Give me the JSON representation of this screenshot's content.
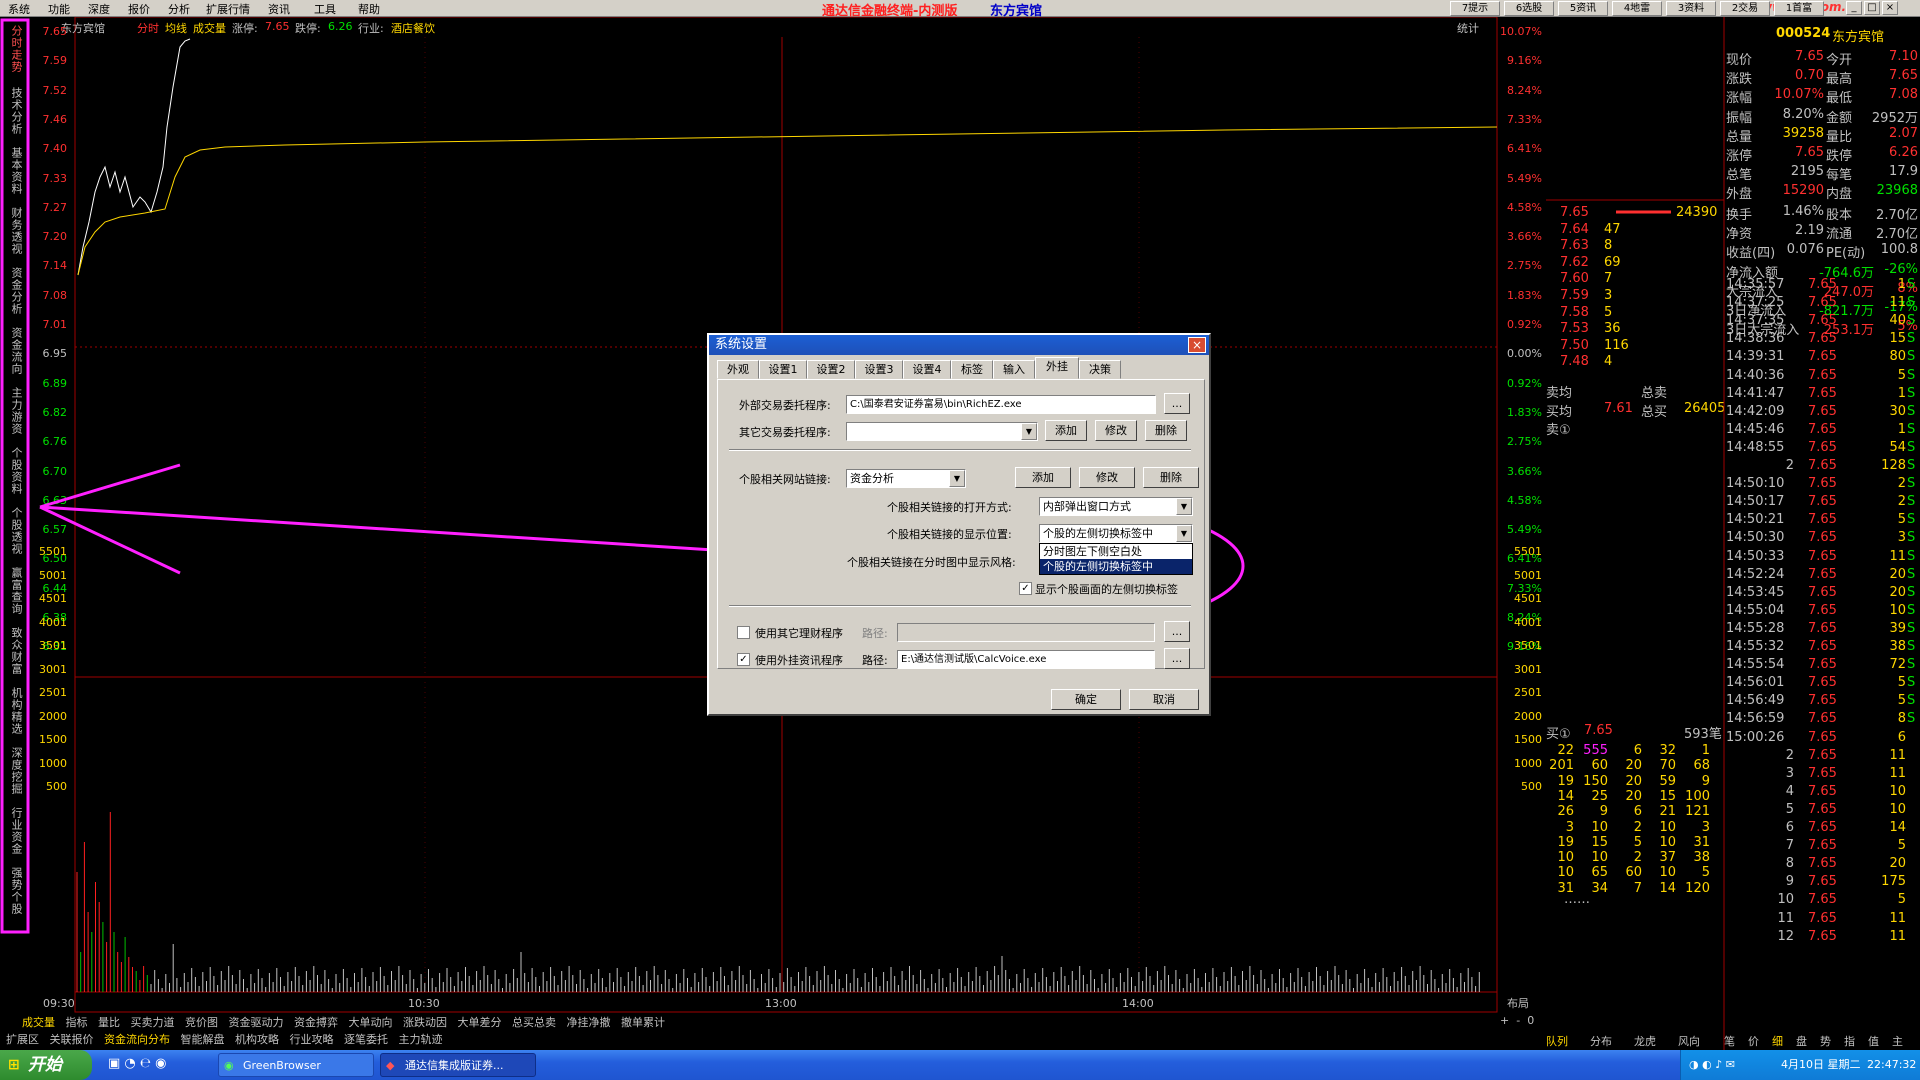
{
  "menubar": {
    "items": [
      "系统",
      "功能",
      "深度",
      "报价",
      "分析",
      "扩展行情",
      "资讯",
      "工具",
      "帮助"
    ],
    "title": "通达信金融终端-内测版",
    "stock_name": "东方宾馆",
    "quick_buttons": [
      "7提示",
      "6选股",
      "5资讯",
      "4地雷",
      "3资料",
      "2交易",
      "1首富"
    ],
    "window_buttons": [
      "_",
      "□",
      "×"
    ],
    "watermark": "www.tdx.com.cn"
  },
  "left_tabs": [
    "分时走势",
    "技术分析",
    "基本资料",
    "财务透视",
    "资金分析",
    "资金流向",
    "主力游资",
    "个股资料",
    "个股透视",
    "赢富查询",
    "致众财富",
    "机构精选",
    "深度挖掘",
    "行业资金",
    "强势个股"
  ],
  "chart": {
    "header": {
      "name": "东方宾馆",
      "l1": "分时",
      "l2": "均线",
      "l3": "成交量",
      "limit_up_label": "涨停:",
      "limit_up": "7.65",
      "limit_down_label": "跌停:",
      "limit_down": "6.26",
      "industry_label": "行业:",
      "industry": "酒店餐饮",
      "stats": "统计"
    },
    "price_labels": [
      "7.65",
      "7.59",
      "7.52",
      "7.46",
      "7.40",
      "7.33",
      "7.27",
      "7.20",
      "7.14",
      "7.08",
      "7.01",
      "6.95",
      "6.89",
      "6.82",
      "6.76",
      "6.70",
      "6.63",
      "6.57",
      "6.50",
      "6.44",
      "6.38",
      "6.31"
    ],
    "pct_labels": [
      "10.07%",
      "9.16%",
      "8.24%",
      "7.33%",
      "6.41%",
      "5.49%",
      "4.58%",
      "3.66%",
      "2.75%",
      "1.83%",
      "0.92%",
      "0.00%",
      "0.92%",
      "1.83%",
      "2.75%",
      "3.66%",
      "4.58%",
      "5.49%",
      "6.41%",
      "7.33%",
      "8.24%",
      "9.16%"
    ],
    "vol_labels": [
      "5501",
      "5001",
      "4501",
      "4001",
      "3501",
      "3001",
      "2501",
      "2000",
      "1500",
      "1000",
      "500"
    ],
    "time_labels": [
      "09:30",
      "10:30",
      "13:00",
      "14:00"
    ],
    "layout_label": "布局",
    "zoom": [
      "+",
      "-",
      "0"
    ]
  },
  "bottom_row1": [
    "成交量",
    "指标",
    "量比",
    "买卖力道",
    "竞价图",
    "资金驱动力",
    "资金搏弈",
    "大单动向",
    "涨跌动因",
    "大单差分",
    "总买总卖",
    "净挂净撤",
    "撤单累计"
  ],
  "bottom_row2": [
    "扩展区",
    "关联报价",
    "资金流向分布",
    "智能解盘",
    "机构攻略",
    "行业攻略",
    "逐笔委托",
    "主力轨迹"
  ],
  "right_panel": {
    "code": "000524",
    "name": "东方宾馆",
    "quote": [
      [
        "现价",
        "7.65",
        "今开",
        "7.10"
      ],
      [
        "涨跌",
        "0.70",
        "最高",
        "7.65"
      ],
      [
        "涨幅",
        "10.07%",
        "最低",
        "7.08"
      ],
      [
        "振幅",
        "8.20%",
        "金额",
        "2952万"
      ],
      [
        "总量",
        "39258",
        "量比",
        "2.07"
      ],
      [
        "涨停",
        "7.65",
        "跌停",
        "6.26"
      ],
      [
        "总笔",
        "2195",
        "每笔",
        "17.9"
      ],
      [
        "外盘",
        "15290",
        "内盘",
        "23968"
      ]
    ],
    "quote2": [
      [
        "换手",
        "1.46%",
        "股本",
        "2.70亿"
      ],
      [
        "净资",
        "2.19",
        "流通",
        "2.70亿"
      ],
      [
        "收益(四)",
        "0.076",
        "PE(动)",
        "100.8"
      ],
      [
        "净流入额",
        "-764.6万",
        "-26%",
        ""
      ],
      [
        "大宗流入",
        "247.0万",
        "8%",
        ""
      ],
      [
        "3日净流入",
        "-821.7万",
        "-17%",
        ""
      ],
      [
        "3日大宗流入",
        "253.1万",
        "5%",
        ""
      ]
    ],
    "price_vol": [
      [
        "7.65",
        "24390"
      ],
      [
        "7.64",
        "47"
      ],
      [
        "7.63",
        "8"
      ],
      [
        "7.62",
        "69"
      ],
      [
        "7.60",
        "7"
      ],
      [
        "7.59",
        "3"
      ],
      [
        "7.58",
        "5"
      ],
      [
        "7.53",
        "36"
      ],
      [
        "7.50",
        "116"
      ],
      [
        "7.48",
        "4"
      ]
    ],
    "avg": {
      "sell_avg_label": "卖均",
      "total_sell_label": "总卖",
      "buy_avg_label": "买均",
      "buy_avg": "7.61",
      "total_buy_label": "总买",
      "total_buy": "26405",
      "sell1_label": "卖①"
    },
    "buy1": {
      "label": "买①",
      "price": "7.65",
      "vol": "593笔"
    },
    "queue": [
      [
        "22",
        "555",
        "6",
        "32",
        "1"
      ],
      [
        "201",
        "60",
        "20",
        "70",
        "68"
      ],
      [
        "19",
        "150",
        "20",
        "59",
        "9"
      ],
      [
        "14",
        "25",
        "20",
        "15",
        "100"
      ],
      [
        "26",
        "9",
        "6",
        "21",
        "121"
      ],
      [
        "3",
        "10",
        "2",
        "10",
        "3"
      ],
      [
        "19",
        "15",
        "5",
        "10",
        "31"
      ],
      [
        "10",
        "10",
        "2",
        "37",
        "38"
      ],
      [
        "10",
        "65",
        "60",
        "10",
        "5"
      ],
      [
        "31",
        "34",
        "7",
        "14",
        "120"
      ]
    ],
    "queue_more": "……",
    "ticks": [
      [
        "14:35:57",
        "7.65",
        "1",
        "S"
      ],
      [
        "14:37:25",
        "7.65",
        "11",
        "S"
      ],
      [
        "14:37:35",
        "7.65",
        "40",
        "S"
      ],
      [
        "14:38:36",
        "7.65",
        "15",
        "S"
      ],
      [
        "14:39:31",
        "7.65",
        "80",
        "S"
      ],
      [
        "14:40:36",
        "7.65",
        "5",
        "S"
      ],
      [
        "14:41:47",
        "7.65",
        "1",
        "S"
      ],
      [
        "14:42:09",
        "7.65",
        "30",
        "S"
      ],
      [
        "14:45:46",
        "7.65",
        "1",
        "S"
      ],
      [
        "14:48:55",
        "7.65",
        "54",
        "S"
      ],
      [
        "2",
        "7.65",
        "128",
        "S"
      ],
      [
        "14:50:10",
        "7.65",
        "2",
        "S"
      ],
      [
        "14:50:17",
        "7.65",
        "2",
        "S"
      ],
      [
        "14:50:21",
        "7.65",
        "5",
        "S"
      ],
      [
        "14:50:30",
        "7.65",
        "3",
        "S"
      ],
      [
        "14:50:33",
        "7.65",
        "11",
        "S"
      ],
      [
        "14:52:24",
        "7.65",
        "20",
        "S"
      ],
      [
        "14:53:45",
        "7.65",
        "20",
        "S"
      ],
      [
        "14:55:04",
        "7.65",
        "10",
        "S"
      ],
      [
        "14:55:28",
        "7.65",
        "39",
        "S"
      ],
      [
        "14:55:32",
        "7.65",
        "38",
        "S"
      ],
      [
        "14:55:54",
        "7.65",
        "72",
        "S"
      ],
      [
        "14:56:01",
        "7.65",
        "5",
        "S"
      ],
      [
        "14:56:49",
        "7.65",
        "5",
        "S"
      ],
      [
        "14:56:59",
        "7.65",
        "8",
        "S"
      ],
      [
        "15:00:26",
        "7.65",
        "6",
        ""
      ],
      [
        "2",
        "7.65",
        "11",
        ""
      ],
      [
        "3",
        "7.65",
        "11",
        ""
      ],
      [
        "4",
        "7.65",
        "10",
        ""
      ],
      [
        "5",
        "7.65",
        "10",
        ""
      ],
      [
        "6",
        "7.65",
        "14",
        ""
      ],
      [
        "7",
        "7.65",
        "5",
        ""
      ],
      [
        "8",
        "7.65",
        "20",
        ""
      ],
      [
        "9",
        "7.65",
        "175",
        ""
      ],
      [
        "10",
        "7.65",
        "5",
        ""
      ],
      [
        "11",
        "7.65",
        "11",
        ""
      ],
      [
        "12",
        "7.65",
        "11",
        ""
      ]
    ],
    "bottom_tabs": [
      "队列",
      "分布",
      "龙虎",
      "风向",
      "笔",
      "价",
      "细",
      "盘",
      "势",
      "指",
      "值",
      "主"
    ]
  },
  "dialog": {
    "title": "系统设置",
    "close": "×",
    "tabs": [
      "外观",
      "设置1",
      "设置2",
      "设置3",
      "设置4",
      "标签",
      "输入",
      "外挂",
      "决策"
    ],
    "ext_trade_label": "外部交易委托程序:",
    "ext_trade_path": "C:\\国泰君安证券富易\\bin\\RichEZ.exe",
    "browse": "...",
    "other_trade_label": "其它交易委托程序:",
    "other_trade_value": "",
    "add": "添加",
    "modify": "修改",
    "delete": "删除",
    "site_link_label": "个股相关网站链接:",
    "site_link_value": "资金分析",
    "open_mode_label": "个股相关链接的打开方式:",
    "open_mode_value": "内部弹出窗口方式",
    "pos_label": "个股相关链接的显示位置:",
    "pos_value": "个股的左侧切换标签中",
    "style_label": "个股相关链接在分时图中显示风格:",
    "dropdown_options": [
      "分时图左下侧空白处",
      "个股的左侧切换标签中"
    ],
    "show_tabs_label": "显示个股画面的左侧切换标签",
    "show_tabs_checked": "✓",
    "use_other_label": "使用其它理财程序",
    "use_other_checked": "",
    "path_label": "路径:",
    "use_other_path": "",
    "use_ext_label": "使用外挂资讯程序",
    "use_ext_checked": "✓",
    "use_ext_path": "E:\\通达信测试版\\CalcVoice.exe",
    "ok": "确定",
    "cancel": "取消"
  },
  "taskbar": {
    "start": "开始",
    "tasks": [
      "GreenBrowser",
      "通达信集成版证券..."
    ],
    "date": "4月10日 星期二",
    "time": "22:47:32"
  }
}
